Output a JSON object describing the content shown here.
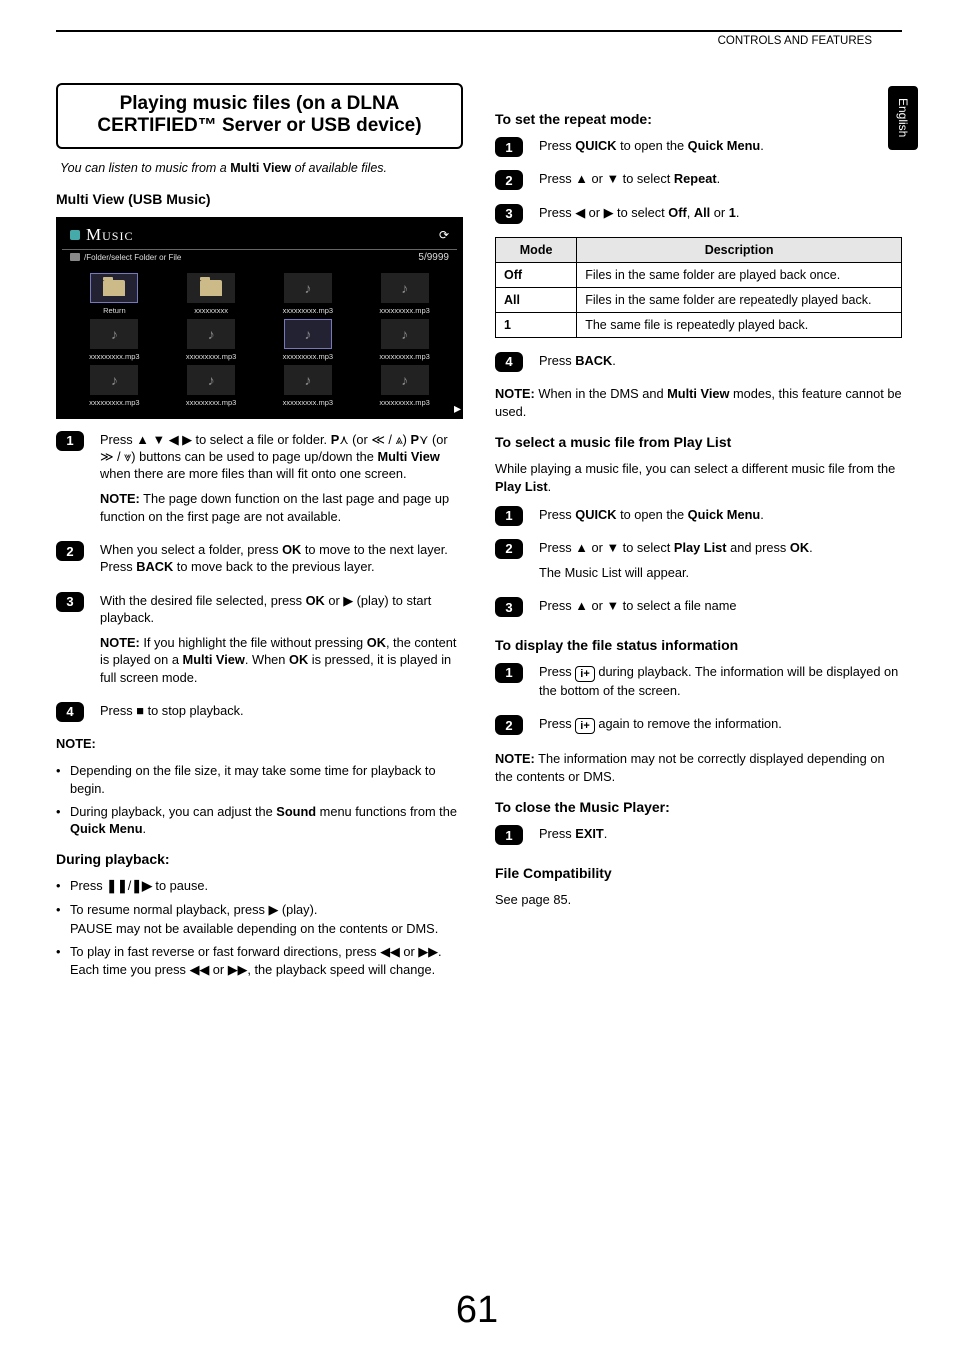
{
  "header": {
    "section": "CONTROLS AND FEATURES",
    "lang_tab": "English"
  },
  "page_number": "61",
  "left": {
    "title": "Playing music files (on a DLNA CERTIFIED™ Server or USB device)",
    "intro_pre": "You can listen to music from a ",
    "intro_bold": "Multi View",
    "intro_post": " of available files.",
    "h_multiview": "Multi View (USB Music)",
    "ss": {
      "title": "Music",
      "crumb": "/Folder/select Folder or File",
      "count": "5/9999",
      "return": "Return",
      "folder": "xxxxxxxxx",
      "file": "xxxxxxxxx.mp3"
    },
    "step1": {
      "l1a": "Press ",
      "l1b": " to select a file or folder. ",
      "l1c": " (or ",
      "l1d": ") ",
      "l1e": " (or ",
      "l1f": ") buttons can be used to page up/down the ",
      "l1g": " when there are more files than will fit onto one screen.",
      "p_up": "P",
      "p_dn": "P",
      "mv": "Multi View",
      "note_label": "NOTE:",
      "note": " The page down function on the last page and page up function on the first page are not available."
    },
    "step2": {
      "a": "When you select a folder, press ",
      "ok": "OK",
      "b": " to move to the next layer. Press ",
      "back": "BACK",
      "c": " to move back to the previous layer."
    },
    "step3": {
      "a": "With the desired file selected, press ",
      "ok": "OK",
      "b": " or ",
      "c": " (play) to start playback.",
      "note_label": "NOTE:",
      "note_a": " If you highlight the file without pressing ",
      "note_b": ", the content is played on a ",
      "note_c": ". When ",
      "note_d": " is pressed, it is played in full screen mode.",
      "mv": "Multi View"
    },
    "step4": {
      "a": "Press ",
      "b": " to stop playback."
    },
    "notes_heading": "NOTE:",
    "notes": {
      "n1": "Depending on the file size, it may take some time for playback to begin.",
      "n2a": "During playback, you can adjust the ",
      "n2b": "Sound",
      "n2c": " menu functions from the ",
      "n2d": "Quick Menu",
      "n2e": "."
    },
    "h_during": "During playback:",
    "during": {
      "d1a": "Press ",
      "d1b": " to pause.",
      "d2a": "To resume normal playback, press ",
      "d2b": " (play).",
      "d2c": "PAUSE may not be available depending on the contents or DMS.",
      "d3a": "To play in fast reverse or fast forward directions, press ",
      "d3b": " or ",
      "d3c": ". Each time you press ",
      "d3d": " or ",
      "d3e": ", the playback speed will change."
    }
  },
  "right": {
    "h_repeat": "To set the repeat mode:",
    "s1": {
      "a": "Press ",
      "q": "QUICK",
      "b": " to open the ",
      "qm": "Quick Menu",
      "c": "."
    },
    "s2": {
      "a": "Press ",
      "b": " or ",
      "c": " to select ",
      "r": "Repeat",
      "d": "."
    },
    "s3": {
      "a": "Press ",
      "b": " or ",
      "c": " to select ",
      "o1": "Off",
      "o2": "All",
      "o3": "1",
      "sep": ", ",
      "or": " or ",
      "end": "."
    },
    "table": {
      "h1": "Mode",
      "h2": "Description",
      "r1k": "Off",
      "r1v": "Files in the same folder are played back once.",
      "r2k": "All",
      "r2v": "Files in the same folder are repeatedly played back.",
      "r3k": "1",
      "r3v": "The same file is repeatedly played back."
    },
    "s4": {
      "a": "Press ",
      "back": "BACK",
      "b": "."
    },
    "note1_label": "NOTE:",
    "note1_a": " When in the DMS and ",
    "note1_b": "Multi View",
    "note1_c": " modes, this feature cannot be used.",
    "h_playlist": "To select a music file from Play List",
    "pl_intro_a": "While playing a music file, you can select a different music file from the ",
    "pl_intro_b": "Play List",
    "pl_intro_c": ".",
    "ps1": {
      "a": "Press ",
      "q": "QUICK",
      "b": " to open the ",
      "qm": "Quick Menu",
      "c": "."
    },
    "ps2": {
      "a": "Press ",
      "b": " or ",
      "c": " to select ",
      "pl": "Play List",
      "d": " and press ",
      "ok": "OK",
      "e": ".",
      "appear": "The Music List will appear."
    },
    "ps3": {
      "a": "Press ",
      "b": " or ",
      "c": " to select a file name"
    },
    "h_status": "To display the file status information",
    "st1": {
      "a": "Press ",
      "b": " during playback. The information will be displayed on the bottom of the screen."
    },
    "st2": {
      "a": "Press ",
      "b": " again to remove the information."
    },
    "status_note_label": "NOTE:",
    "status_note": " The information may not be correctly displayed depending on the contents or DMS.",
    "h_close": "To close the Music Player:",
    "close1": {
      "a": "Press ",
      "exit": "EXIT",
      "b": "."
    },
    "h_compat": "File Compatibility",
    "compat": "See page 85."
  }
}
